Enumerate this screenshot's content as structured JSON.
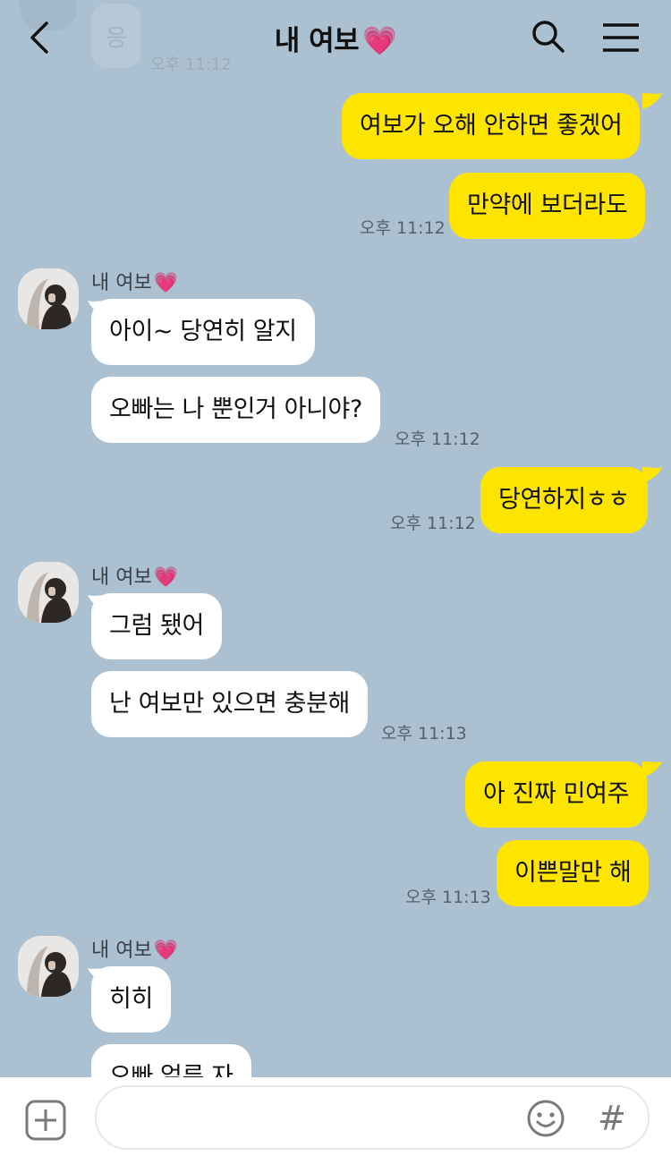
{
  "header": {
    "title": "내 여보",
    "title_heart": "💗"
  },
  "ghost": {
    "bubble_text": "응",
    "time": "오후 11:12"
  },
  "sender": {
    "name": "내 여보",
    "heart": "💗"
  },
  "messages": [
    {
      "text": "여보가 오해 안하면 좋겠어"
    },
    {
      "text": "만약에 보더라도",
      "time": "오후 11:12"
    },
    {
      "text": "아이~ 당연히 알지"
    },
    {
      "text": "오빠는 나 뿐인거 아니야?",
      "time": "오후 11:12"
    },
    {
      "text": "당연하지ㅎㅎ",
      "time": "오후 11:12"
    },
    {
      "text": "그럼 됐어"
    },
    {
      "text": "난 여보만 있으면 충분해",
      "time": "오후 11:13"
    },
    {
      "text": "아 진짜 민여주"
    },
    {
      "text": "이쁜말만 해",
      "time": "오후 11:13"
    },
    {
      "text": "히히"
    },
    {
      "text": "오빠 얼른 자"
    }
  ],
  "composer": {
    "placeholder": "",
    "hash": "#"
  },
  "colors": {
    "background": "#abc1d1",
    "my_bubble": "#fee500",
    "other_bubble": "#ffffff",
    "heart": "#ff4f9a"
  },
  "icons": [
    "back-arrow-icon",
    "search-icon",
    "menu-icon",
    "plus-icon",
    "emoji-icon",
    "hash-icon"
  ]
}
